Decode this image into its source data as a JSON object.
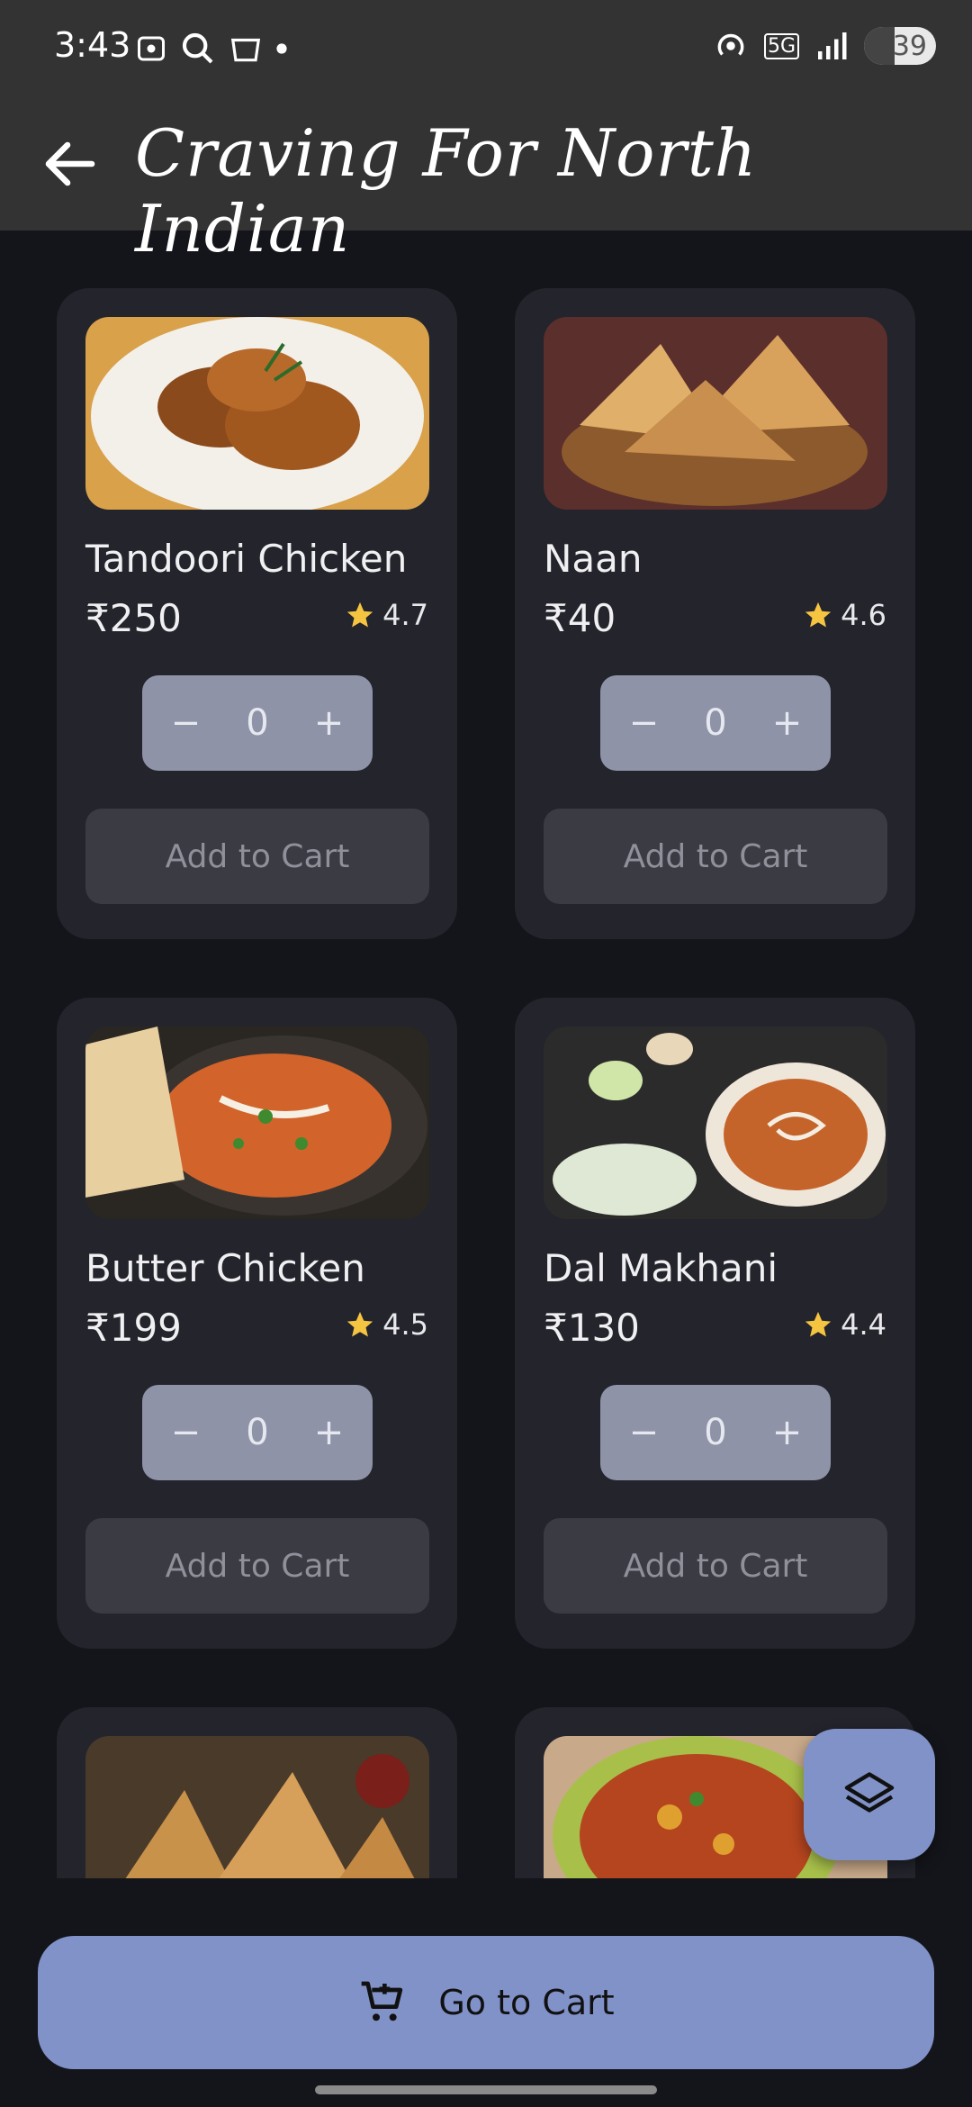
{
  "status": {
    "time": "3:43",
    "battery": "39",
    "network": "5G"
  },
  "app_bar": {
    "title": "Craving For North Indian"
  },
  "items": [
    {
      "name": "Tandoori Chicken",
      "price": "₹250",
      "rating": "4.7",
      "qty": "0",
      "add_label": "Add to Cart"
    },
    {
      "name": "Naan",
      "price": "₹40",
      "rating": "4.6",
      "qty": "0",
      "add_label": "Add to Cart"
    },
    {
      "name": "Butter Chicken",
      "price": "₹199",
      "rating": "4.5",
      "qty": "0",
      "add_label": "Add to Cart"
    },
    {
      "name": "Dal Makhani",
      "price": "₹130",
      "rating": "4.4",
      "qty": "0",
      "add_label": "Add to Cart"
    }
  ],
  "bottom": {
    "go_cart_label": "Go to Cart"
  },
  "colors": {
    "accent": "#8092c8",
    "card": "#23242c",
    "background": "#14151a"
  }
}
